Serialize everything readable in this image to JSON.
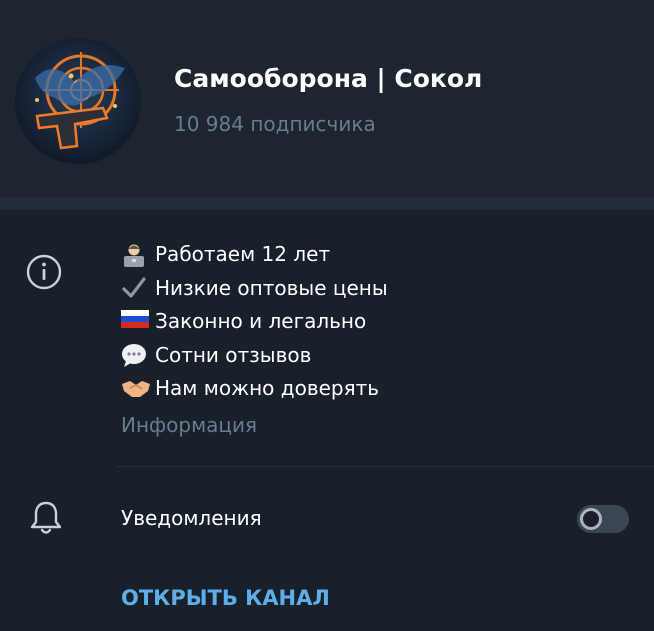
{
  "channel": {
    "title": "Самооборона | Сокол",
    "subscribers": "10 984 подписчика"
  },
  "info": {
    "lines": [
      {
        "icon": "person-laptop-emoji",
        "text": "Работаем 12 лет"
      },
      {
        "icon": "check-mark-emoji",
        "text": "Низкие оптовые цены"
      },
      {
        "icon": "russia-flag-emoji",
        "text": "Законно и легально"
      },
      {
        "icon": "speech-bubble-emoji",
        "text": "Сотни отзывов"
      },
      {
        "icon": "handshake-emoji",
        "text": "Нам можно доверять"
      }
    ],
    "caption": "Информация"
  },
  "notifications": {
    "label": "Уведомления",
    "enabled": false
  },
  "actions": {
    "open_channel": "ОТКРЫТЬ КАНАЛ"
  },
  "colors": {
    "background": "#18202a",
    "header": "#1c2530",
    "muted_text": "#6a7b8d",
    "accent": "#5eaeea"
  }
}
